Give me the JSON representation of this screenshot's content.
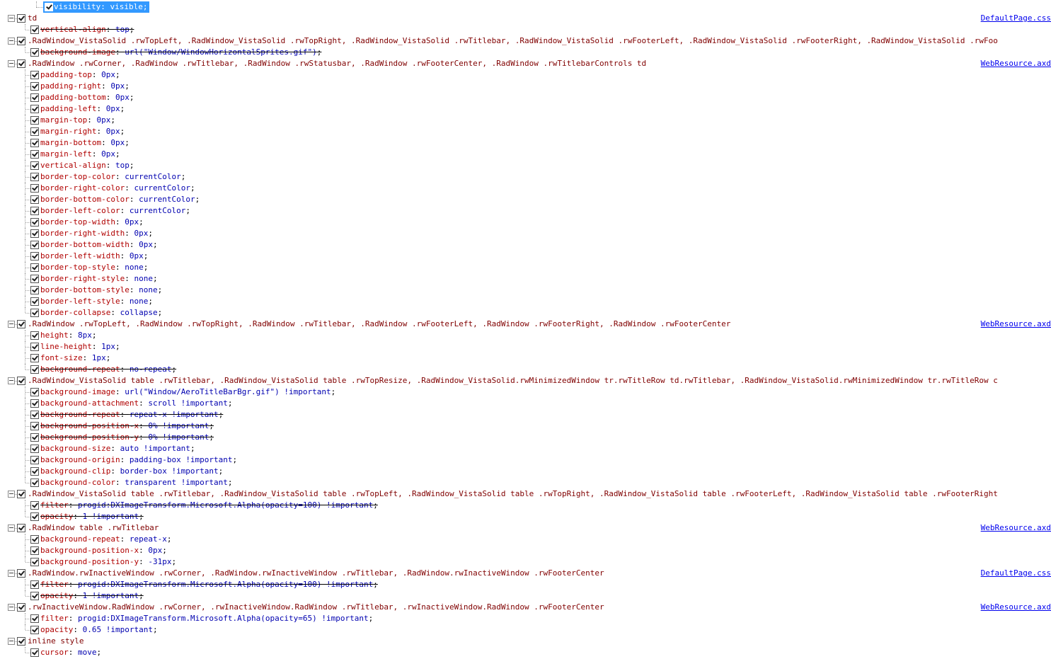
{
  "selected_line": {
    "prop": "visibility",
    "value": "visible"
  },
  "rules": [
    {
      "selector": "td",
      "source": "DefaultPage.css",
      "decls": [
        {
          "prop": "vertical-align",
          "value": "top",
          "struck": true
        }
      ]
    },
    {
      "selector": ".RadWindow_VistaSolid .rwTopLeft, .RadWindow_VistaSolid .rwTopRight, .RadWindow_VistaSolid .rwTitlebar, .RadWindow_VistaSolid .rwFooterLeft, .RadWindow_VistaSolid .rwFooterRight, .RadWindow_VistaSolid .rwFoo",
      "source": "",
      "decls": [
        {
          "prop": "background-image",
          "value": "url(\"Window/WindowHorizontalSprites.gif\")",
          "struck": true
        }
      ]
    },
    {
      "selector": ".RadWindow .rwCorner, .RadWindow .rwTitlebar, .RadWindow .rwStatusbar, .RadWindow .rwFooterCenter, .RadWindow .rwTitlebarControls td",
      "source": "WebResource.axd",
      "decls": [
        {
          "prop": "padding-top",
          "value": "0px",
          "struck": false
        },
        {
          "prop": "padding-right",
          "value": "0px",
          "struck": false
        },
        {
          "prop": "padding-bottom",
          "value": "0px",
          "struck": false
        },
        {
          "prop": "padding-left",
          "value": "0px",
          "struck": false
        },
        {
          "prop": "margin-top",
          "value": "0px",
          "struck": false
        },
        {
          "prop": "margin-right",
          "value": "0px",
          "struck": false
        },
        {
          "prop": "margin-bottom",
          "value": "0px",
          "struck": false
        },
        {
          "prop": "margin-left",
          "value": "0px",
          "struck": false
        },
        {
          "prop": "vertical-align",
          "value": "top",
          "struck": false
        },
        {
          "prop": "border-top-color",
          "value": "currentColor",
          "struck": false
        },
        {
          "prop": "border-right-color",
          "value": "currentColor",
          "struck": false
        },
        {
          "prop": "border-bottom-color",
          "value": "currentColor",
          "struck": false
        },
        {
          "prop": "border-left-color",
          "value": "currentColor",
          "struck": false
        },
        {
          "prop": "border-top-width",
          "value": "0px",
          "struck": false
        },
        {
          "prop": "border-right-width",
          "value": "0px",
          "struck": false
        },
        {
          "prop": "border-bottom-width",
          "value": "0px",
          "struck": false
        },
        {
          "prop": "border-left-width",
          "value": "0px",
          "struck": false
        },
        {
          "prop": "border-top-style",
          "value": "none",
          "struck": false
        },
        {
          "prop": "border-right-style",
          "value": "none",
          "struck": false
        },
        {
          "prop": "border-bottom-style",
          "value": "none",
          "struck": false
        },
        {
          "prop": "border-left-style",
          "value": "none",
          "struck": false
        },
        {
          "prop": "border-collapse",
          "value": "collapse",
          "struck": false
        }
      ]
    },
    {
      "selector": ".RadWindow .rwTopLeft, .RadWindow .rwTopRight, .RadWindow .rwTitlebar, .RadWindow .rwFooterLeft, .RadWindow .rwFooterRight, .RadWindow .rwFooterCenter",
      "source": "WebResource.axd",
      "decls": [
        {
          "prop": "height",
          "value": "8px",
          "struck": false
        },
        {
          "prop": "line-height",
          "value": "1px",
          "struck": false
        },
        {
          "prop": "font-size",
          "value": "1px",
          "struck": false
        },
        {
          "prop": "background-repeat",
          "value": "no-repeat",
          "struck": true
        }
      ]
    },
    {
      "selector": ".RadWindow_VistaSolid table .rwTitlebar, .RadWindow_VistaSolid table .rwTopResize, .RadWindow_VistaSolid.rwMinimizedWindow tr.rwTitleRow td.rwTitlebar, .RadWindow_VistaSolid.rwMinimizedWindow tr.rwTitleRow c",
      "source": "",
      "decls": [
        {
          "prop": "background-image",
          "value": "url(\"Window/AeroTitleBarBgr.gif\") !important",
          "struck": false
        },
        {
          "prop": "background-attachment",
          "value": "scroll !important",
          "struck": false
        },
        {
          "prop": "background-repeat",
          "value": "repeat-x !important",
          "struck": true
        },
        {
          "prop": "background-position-x",
          "value": "0% !important",
          "struck": true
        },
        {
          "prop": "background-position-y",
          "value": "0% !important",
          "struck": true
        },
        {
          "prop": "background-size",
          "value": "auto !important",
          "struck": false
        },
        {
          "prop": "background-origin",
          "value": "padding-box !important",
          "struck": false
        },
        {
          "prop": "background-clip",
          "value": "border-box !important",
          "struck": false
        },
        {
          "prop": "background-color",
          "value": "transparent !important",
          "struck": false
        }
      ]
    },
    {
      "selector": ".RadWindow_VistaSolid table .rwTitlebar, .RadWindow_VistaSolid table .rwTopLeft, .RadWindow_VistaSolid table .rwTopRight, .RadWindow_VistaSolid table .rwFooterLeft, .RadWindow_VistaSolid table .rwFooterRight",
      "source": "",
      "decls": [
        {
          "prop": "filter",
          "value": "progid:DXImageTransform.Microsoft.Alpha(opacity=100) !important",
          "struck": true
        },
        {
          "prop": "opacity",
          "value": "1 !important",
          "struck": true
        }
      ]
    },
    {
      "selector": ".RadWindow table .rwTitlebar",
      "source": "WebResource.axd",
      "decls": [
        {
          "prop": "background-repeat",
          "value": "repeat-x",
          "struck": false
        },
        {
          "prop": "background-position-x",
          "value": "0px",
          "struck": false
        },
        {
          "prop": "background-position-y",
          "value": "-31px",
          "struck": false
        }
      ]
    },
    {
      "selector": ".RadWindow.rwInactiveWindow .rwCorner, .RadWindow.rwInactiveWindow .rwTitlebar, .RadWindow.rwInactiveWindow .rwFooterCenter",
      "source": "DefaultPage.css",
      "decls": [
        {
          "prop": "filter",
          "value": "progid:DXImageTransform.Microsoft.Alpha(opacity=100) !important",
          "struck": true
        },
        {
          "prop": "opacity",
          "value": "1 !important",
          "struck": true
        }
      ]
    },
    {
      "selector": ".rwInactiveWindow.RadWindow .rwCorner, .rwInactiveWindow.RadWindow .rwTitlebar, .rwInactiveWindow.RadWindow .rwFooterCenter",
      "source": "WebResource.axd",
      "decls": [
        {
          "prop": "filter",
          "value": "progid:DXImageTransform.Microsoft.Alpha(opacity=65) !important",
          "struck": false
        },
        {
          "prop": "opacity",
          "value": "0.65 !important",
          "struck": false
        }
      ]
    },
    {
      "selector": "inline style",
      "source": "",
      "decls": [
        {
          "prop": "cursor",
          "value": "move",
          "struck": false
        }
      ]
    }
  ]
}
